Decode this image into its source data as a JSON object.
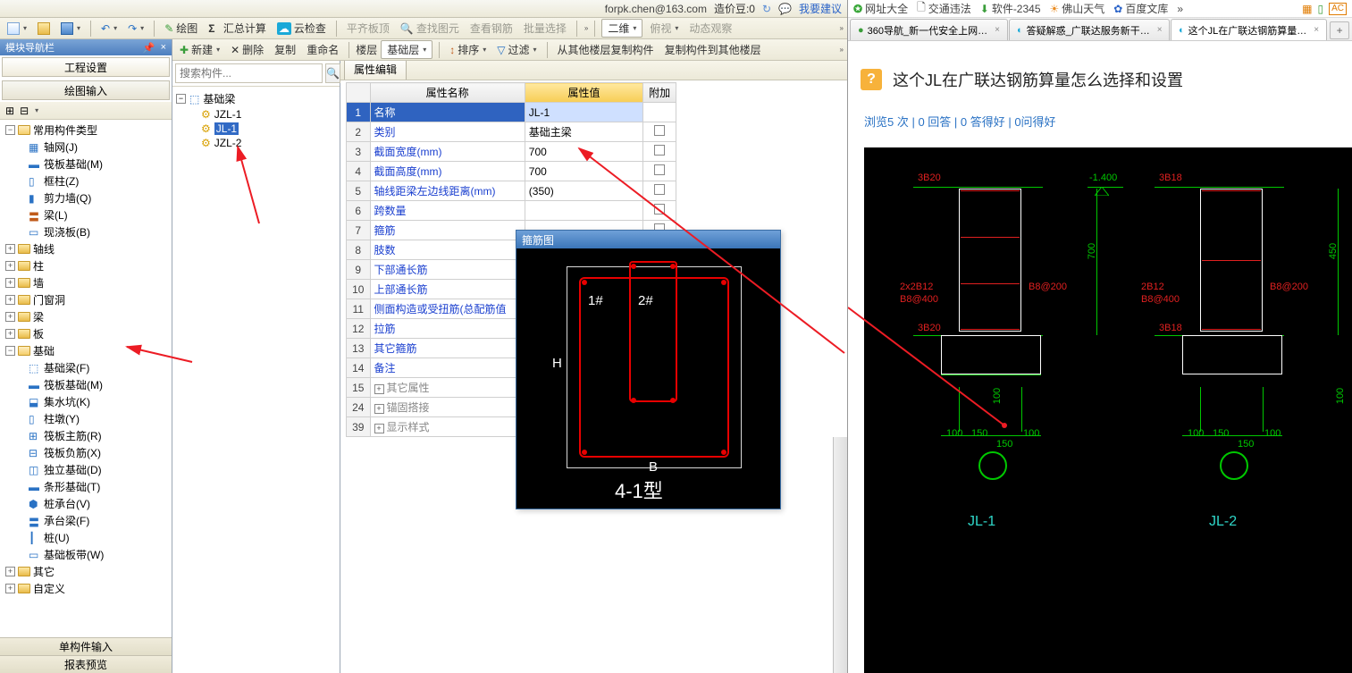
{
  "top_info": {
    "account": "forpk.chen@163.com",
    "credit_lbl": "造价豆:0",
    "suggest": "我要建议"
  },
  "tb1": {
    "draw": "绘图",
    "sum": "汇总计算",
    "cloud": "云检查",
    "flat": "平齐板顶",
    "find": "查找图元",
    "viewrebar": "查看钢筋",
    "batch": "批量选择",
    "twoD": "二维",
    "topview": "俯视",
    "dynview": "动态观察"
  },
  "tb3": {
    "new": "新建",
    "del": "删除",
    "copy": "复制",
    "rename": "重命名",
    "floor": "楼层",
    "floor_val": "基础层",
    "sort": "排序",
    "filter": "过滤",
    "copyfrom": "从其他楼层复制构件",
    "copyto": "复制构件到其他楼层"
  },
  "nav": {
    "title": "模块导航栏",
    "tab_proj": "工程设置",
    "tab_draw": "绘图输入",
    "common": "常用构件类型",
    "axis_net": "轴网(J)",
    "raft_base": "筏板基础(M)",
    "frame_col": "框柱(Z)",
    "shear_wall": "剪力墙(Q)",
    "beam": "梁(L)",
    "slab": "现浇板(B)",
    "axis": "轴线",
    "column": "柱",
    "wall": "墙",
    "opening": "门窗洞",
    "beam2": "梁",
    "slab2": "板",
    "foundation": "基础",
    "found_beam": "基础梁(F)",
    "raft2": "筏板基础(M)",
    "sump": "集水坑(K)",
    "col_pier": "柱墩(Y)",
    "raft_main": "筏板主筋(R)",
    "raft_neg": "筏板负筋(X)",
    "iso_found": "独立基础(D)",
    "strip_found": "条形基础(T)",
    "pile_cap": "桩承台(V)",
    "cap_beam": "承台梁(F)",
    "pile": "桩(U)",
    "base_slab": "基础板带(W)",
    "other": "其它",
    "custom": "自定义",
    "b_single": "单构件输入",
    "b_report": "报表预览"
  },
  "mid": {
    "search_ph": "搜索构件...",
    "root": "基础梁",
    "items": [
      "JZL-1",
      "JL-1",
      "JZL-2"
    ]
  },
  "prop": {
    "tab": "属性编辑",
    "h_name": "属性名称",
    "h_val": "属性值",
    "h_extra": "附加",
    "rows": [
      {
        "n": "1",
        "k": "名称",
        "v": "JL-1"
      },
      {
        "n": "2",
        "k": "类别",
        "v": "基础主梁"
      },
      {
        "n": "3",
        "k": "截面宽度(mm)",
        "v": "700"
      },
      {
        "n": "4",
        "k": "截面高度(mm)",
        "v": "700"
      },
      {
        "n": "5",
        "k": "轴线距梁左边线距离(mm)",
        "v": "(350)"
      },
      {
        "n": "6",
        "k": "跨数量",
        "v": ""
      },
      {
        "n": "7",
        "k": "箍筋",
        "v": ""
      },
      {
        "n": "8",
        "k": "肢数",
        "v": ""
      },
      {
        "n": "9",
        "k": "下部通长筋",
        "v": ""
      },
      {
        "n": "10",
        "k": "上部通长筋",
        "v": ""
      },
      {
        "n": "11",
        "k": "侧面构造或受扭筋(总配筋值",
        "v": ""
      },
      {
        "n": "12",
        "k": "拉筋",
        "v": ""
      },
      {
        "n": "13",
        "k": "其它箍筋",
        "v": ""
      },
      {
        "n": "14",
        "k": "备注",
        "v": ""
      },
      {
        "n": "15",
        "k": "其它属性",
        "v": "",
        "plus": true
      },
      {
        "n": "24",
        "k": "锚固搭接",
        "v": "",
        "plus": true
      },
      {
        "n": "39",
        "k": "显示样式",
        "v": "",
        "plus": true
      }
    ]
  },
  "stirrup": {
    "title": "箍筋图",
    "n1": "1#",
    "n2": "2#",
    "H": "H",
    "B": "B",
    "type": "4-1型"
  },
  "browser": {
    "favs": {
      "all": "网址大全",
      "traffic": "交通违法",
      "soft": "软件-2345",
      "weather": "佛山天气",
      "wenku": "百度文库"
    },
    "tabs": {
      "t1": "360导航_新一代安全上网…",
      "t2": "答疑解惑_广联达服务新干…",
      "t3": "这个JL在广联达钢筋算量…"
    },
    "question": "这个JL在广联达钢筋算量怎么选择和设置",
    "stats": "浏览5 次 | 0 回答 | 0 答得好 | 0问得好",
    "diagram": {
      "r1": "3B20",
      "r2": "2x2B12",
      "r3": "B8@400",
      "r4": "3B20",
      "r5": "-1.400",
      "r6": "B8@200",
      "r7": "3B18",
      "r8": "2B12",
      "r9": "B8@400",
      "r10": "3B18",
      "r11": "B8@200",
      "h700": "700",
      "h450": "450",
      "h100": "100",
      "d100": "100",
      "d150": "150",
      "jl1": "JL-1",
      "jl2": "JL-2"
    }
  }
}
